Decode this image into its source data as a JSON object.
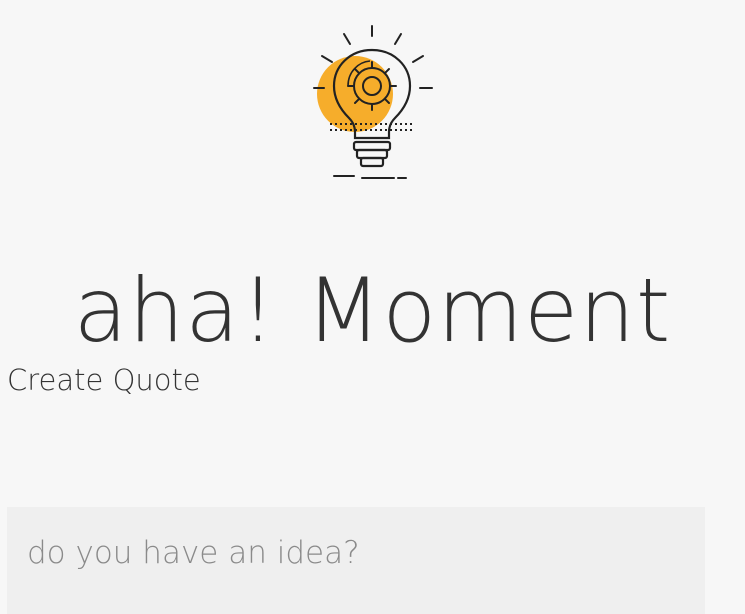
{
  "logo": {
    "icon": "lightbulb-gear-icon",
    "accent_color": "#f6ad2b",
    "stroke_color": "#222222"
  },
  "header": {
    "title": "aha! Moment"
  },
  "nav": {
    "create_quote_label": "Create Quote"
  },
  "idea_input": {
    "value": "",
    "placeholder": "do you have an idea?"
  }
}
